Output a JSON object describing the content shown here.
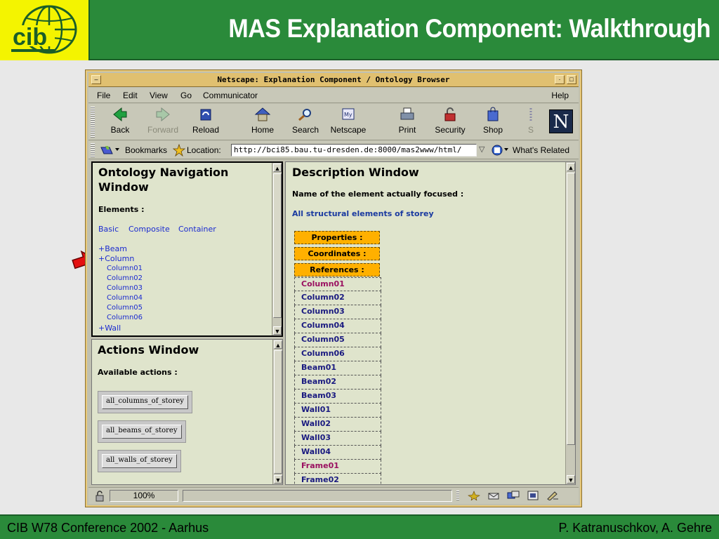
{
  "slide": {
    "title": "MAS Explanation Component: Walkthrough",
    "footer_left": "CIB W78 Conference 2002 - Aarhus",
    "footer_right": "P. Katranuschkov, A. Gehre",
    "accent_color": "#2a8a3a",
    "logo_color": "#f4f400"
  },
  "window": {
    "title": "Netscape: Explanation Component / Ontology Browser"
  },
  "menu": [
    "File",
    "Edit",
    "View",
    "Go",
    "Communicator",
    "Help"
  ],
  "toolbar": {
    "back": "Back",
    "forward": "Forward",
    "reload": "Reload",
    "home": "Home",
    "search": "Search",
    "netscape": "Netscape",
    "print": "Print",
    "security": "Security",
    "shop": "Shop",
    "stop": "S"
  },
  "locbar": {
    "bookmarks": "Bookmarks",
    "location_label": "Location:",
    "url": "http://bci85.bau.tu-dresden.de:8000/mas2www/html/",
    "whats_related": "What's Related"
  },
  "nav": {
    "title_line1": "Ontology Navigation",
    "title_line2": "Window",
    "elements_label": "Elements :",
    "filters": [
      "Basic",
      "Composite",
      "Container"
    ],
    "tree": {
      "beam": "+Beam",
      "column": "+Column",
      "children": [
        "Column01",
        "Column02",
        "Column03",
        "Column04",
        "Column05",
        "Column06"
      ],
      "wall": "+Wall"
    }
  },
  "actions": {
    "title": "Actions Window",
    "available_label": "Available actions :",
    "buttons": [
      "all_columns_of_storey",
      "all_beams_of_storey",
      "all_walls_of_storey"
    ]
  },
  "description": {
    "title": "Description Window",
    "focused_label": "Name of the element actually focused :",
    "focused_value": "All structural elements of storey",
    "tabs": [
      "Properties :",
      "Coordinates :",
      "References :"
    ],
    "references": [
      "Column01",
      "Column02",
      "Column03",
      "Column04",
      "Column05",
      "Column06",
      "Beam01",
      "Beam02",
      "Beam03",
      "Wall01",
      "Wall02",
      "Wall03",
      "Wall04",
      "Frame01",
      "Frame02"
    ]
  },
  "status": {
    "progress": "100%"
  }
}
